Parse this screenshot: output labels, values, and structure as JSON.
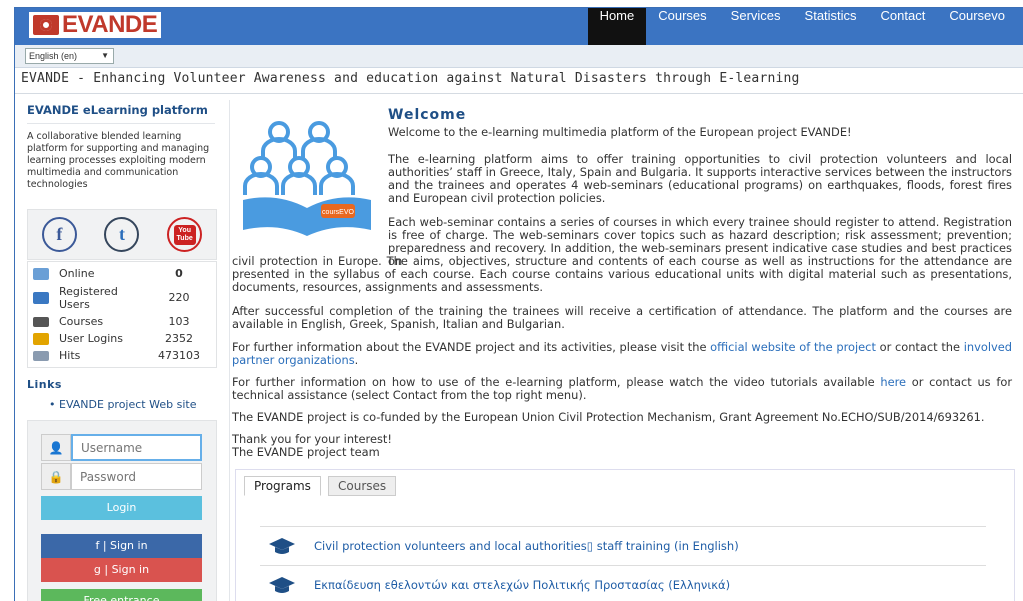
{
  "brand": {
    "name": "EVANDE"
  },
  "nav": {
    "items": [
      {
        "label": "Home",
        "active": true
      },
      {
        "label": "Courses",
        "active": false
      },
      {
        "label": "Services",
        "active": false
      },
      {
        "label": "Statistics",
        "active": false
      },
      {
        "label": "Contact",
        "active": false
      },
      {
        "label": "Coursevo",
        "active": false
      }
    ]
  },
  "language": {
    "selected": "English (en)"
  },
  "page_title": "EVANDE - Enhancing Volunteer Awareness and education against Natural Disasters through E-learning",
  "sidebar": {
    "platform_name": "EVANDE eLearning platform",
    "platform_description": "A collaborative blended learning platform for supporting and managing learning processes exploiting modern multimedia and communication technologies",
    "social": [
      {
        "icon": "facebook-icon",
        "glyph": "f",
        "color": "#3b5998"
      },
      {
        "icon": "tumblr-icon",
        "glyph": "t",
        "color": "#35465c"
      },
      {
        "icon": "youtube-icon",
        "glyph": "You Tube",
        "color": "#cc2222"
      }
    ],
    "stats": [
      {
        "label": "Online",
        "value": "0"
      },
      {
        "label": "Registered Users",
        "value": "220"
      },
      {
        "label": "Courses",
        "value": "103"
      },
      {
        "label": "User Logins",
        "value": "2352"
      },
      {
        "label": "Hits",
        "value": "473103"
      }
    ],
    "links_heading": "Links",
    "links": [
      {
        "label": "EVANDE project Web site"
      }
    ],
    "login": {
      "username_placeholder": "Username",
      "password_placeholder": "Password",
      "login_label": "Login",
      "facebook_label": "f | Sign in",
      "google_label": "g | Sign in",
      "free_label": "Free entrance"
    }
  },
  "main": {
    "welcome_title": "Welcome",
    "intro": "Welcome to the e-learning multimedia platform of the European project EVANDE!",
    "hero_badge": "coursEVO",
    "p1": "The e-learning platform aims to offer training opportunities to civil protection volunteers and local authorities’ staff in Greece, Italy, Spain and Bulgaria. It supports interactive services between the instructors and the trainees and operates 4 web-seminars (educational programs) on earthquakes, floods, forest fires and European civil protection policies.",
    "p2_top": "Each web-seminar contains a series of courses in which every trainee should register to attend. Registration is free of charge. The web-seminars cover topics such as hazard description; risk assessment; prevention; preparedness and recovery. In addition, the web-seminars present indicative case studies and best practices on",
    "p2_bottom": "civil protection in Europe. The aims, objectives, structure and contents of each course as well as instructions for the attendance are presented in the syllabus of each course. Each course contains various educational units with digital material such as presentations, documents, resources, assignments and assessments.",
    "p3": "After successful completion of the training the trainees will receive a certification of attendance. The platform and the courses are available in English, Greek, Spanish, Italian and Bulgarian.",
    "p4_before": "For further information about the EVANDE project and its activities, please visit the ",
    "p4_link1": "official website of the project",
    "p4_mid": " or contact the ",
    "p4_link2": "involved partner organizations",
    "p4_after": ".",
    "p5_before": "For further information on how to use of the e-learning platform, please watch the video tutorials available ",
    "p5_link": "here",
    "p5_after": " or contact us for technical assistance (select Contact from the top right menu).",
    "p6": "The EVANDE project is co-funded by the European Union Civil Protection Mechanism, Grant Agreement No.ECHO/SUB/2014/693261.",
    "thanks": "Thank you for your interest!",
    "team": "The EVANDE project team",
    "tabs": [
      {
        "label": "Programs",
        "active": true
      },
      {
        "label": "Courses",
        "active": false
      }
    ],
    "programs": [
      {
        "label": "Civil protection volunteers and local authorities▯ staff training (in English)"
      },
      {
        "label": "Εκπαίδευση εθελοντών και στελεχών Πολιτικής Προστασίας (Ελληνικά)"
      }
    ]
  }
}
